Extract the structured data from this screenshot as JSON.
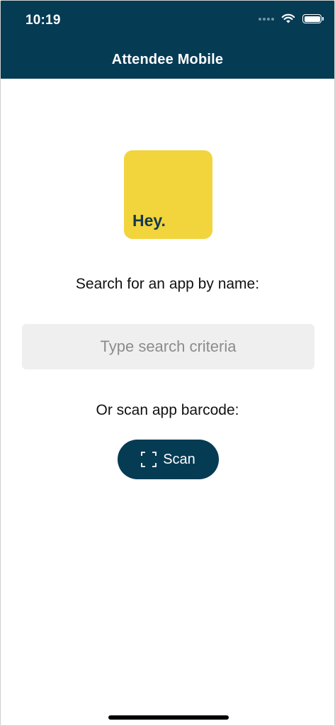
{
  "status_bar": {
    "time": "10:19",
    "icons": [
      "signal-dots-icon",
      "wifi-icon",
      "battery-icon"
    ]
  },
  "nav": {
    "title": "Attendee Mobile"
  },
  "logo": {
    "text": "Hey.",
    "background_color": "#f2d43c",
    "text_color": "#15394a"
  },
  "search": {
    "label": "Search for an app by name:",
    "placeholder": "Type search criteria",
    "value": ""
  },
  "scan": {
    "label": "Or scan app barcode:",
    "button_label": "Scan",
    "icon": "scan-frame-icon"
  },
  "colors": {
    "brand_dark": "#063b54",
    "input_background": "#efefef",
    "accent_yellow": "#f2d43c"
  }
}
